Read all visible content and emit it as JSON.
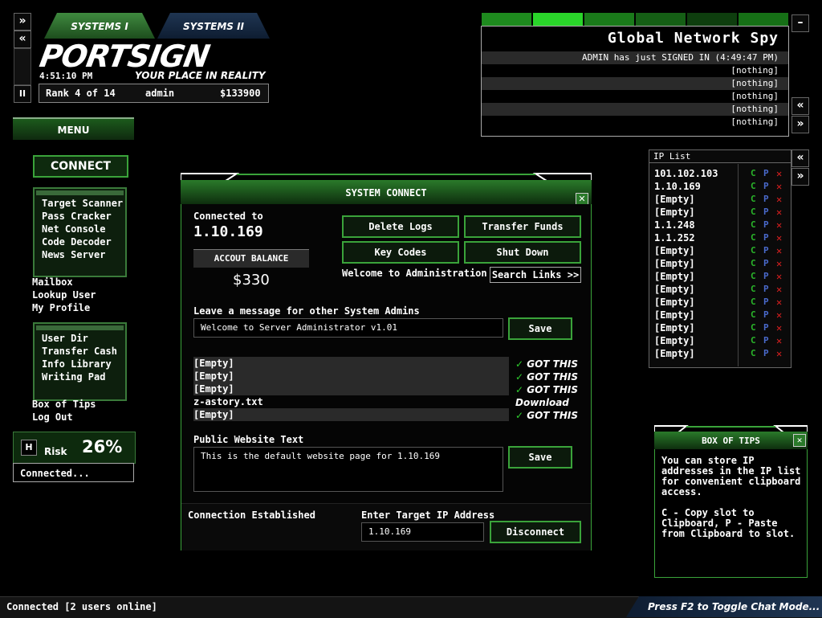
{
  "tabs": [
    "SYSTEMS I",
    "SYSTEMS II"
  ],
  "logo": "PORTSIGN",
  "tagline": "YOUR PLACE IN REALITY",
  "clock": "4:51:10 PM",
  "rank": {
    "rank_text": "Rank 4 of 14",
    "user": "admin",
    "money": "$133900"
  },
  "left_nav_buttons": {
    "forward": "»",
    "back": "«",
    "pause": "II"
  },
  "menu": {
    "header": "MENU",
    "connect": "CONNECT",
    "group1": [
      "Target Scanner",
      "Pass Cracker",
      "Net Console",
      "Code Decoder",
      "News Server"
    ],
    "links1": [
      "Mailbox",
      "Lookup User",
      "My Profile"
    ],
    "group2": [
      "User Dir",
      "Transfer Cash",
      "Info Library",
      "Writing Pad"
    ],
    "links2": [
      "Box of Tips",
      "Log Out"
    ]
  },
  "risk": {
    "h_label": "H",
    "label": "Risk",
    "value": "26%"
  },
  "connection_status": "Connected...",
  "spy": {
    "title": "Global Network Spy",
    "minimize": "–",
    "rows": [
      "ADMIN has just SIGNED IN (4:49:47 PM)",
      "[nothing]",
      "[nothing]",
      "[nothing]",
      "[nothing]",
      "[nothing]"
    ]
  },
  "side_buttons": {
    "collapse": "«",
    "expand": "»"
  },
  "ip_list": {
    "title": "IP List",
    "letters": {
      "c": "C",
      "p": "P",
      "x": "✕"
    },
    "entries": [
      "101.102.103",
      "1.10.169",
      "[Empty]",
      "[Empty]",
      "1.1.248",
      "1.1.252",
      "[Empty]",
      "[Empty]",
      "[Empty]",
      "[Empty]",
      "[Empty]",
      "[Empty]",
      "[Empty]",
      "[Empty]",
      "[Empty]"
    ]
  },
  "window": {
    "title": "SYSTEM CONNECT",
    "close": "✕",
    "connected_to_label": "Connected to",
    "connected_ip": "1.10.169",
    "balance_label": "ACCOUT BALANCE",
    "balance": "$330",
    "buttons": {
      "delete_logs": "Delete Logs",
      "transfer_funds": "Transfer Funds",
      "key_codes": "Key Codes",
      "shut_down": "Shut Down",
      "search_links": "Search Links >>"
    },
    "welcome": "Welcome to Administration",
    "message_label": "Leave a message for other System Admins",
    "message_value": "Welcome to Server Administrator v1.01",
    "save": "Save",
    "files": [
      {
        "name": "[Empty]",
        "status": "GOT THIS",
        "got": "✓"
      },
      {
        "name": "[Empty]",
        "status": "GOT THIS",
        "got": "✓"
      },
      {
        "name": "[Empty]",
        "status": "GOT THIS",
        "got": "✓"
      },
      {
        "name": "z-astory.txt",
        "status": "Download",
        "got": ""
      },
      {
        "name": "[Empty]",
        "status": "GOT THIS",
        "got": "✓"
      }
    ],
    "website_label": "Public Website Text",
    "website_value": "This is the default website page for 1.10.169",
    "footer_status": "Connection Established",
    "target_label": "Enter Target IP Address",
    "target_value": "1.10.169",
    "disconnect": "Disconnect"
  },
  "tips": {
    "title": "BOX OF TIPS",
    "close": "✕",
    "text": "You can store IP addresses in the IP list for convenient clipboard access.\n\nC - Copy slot to Clipboard, P - Paste from Clipboard to slot."
  },
  "status_bar": "Connected [2 users online]",
  "chat_hint": "Press F2 to Toggle Chat Mode..."
}
